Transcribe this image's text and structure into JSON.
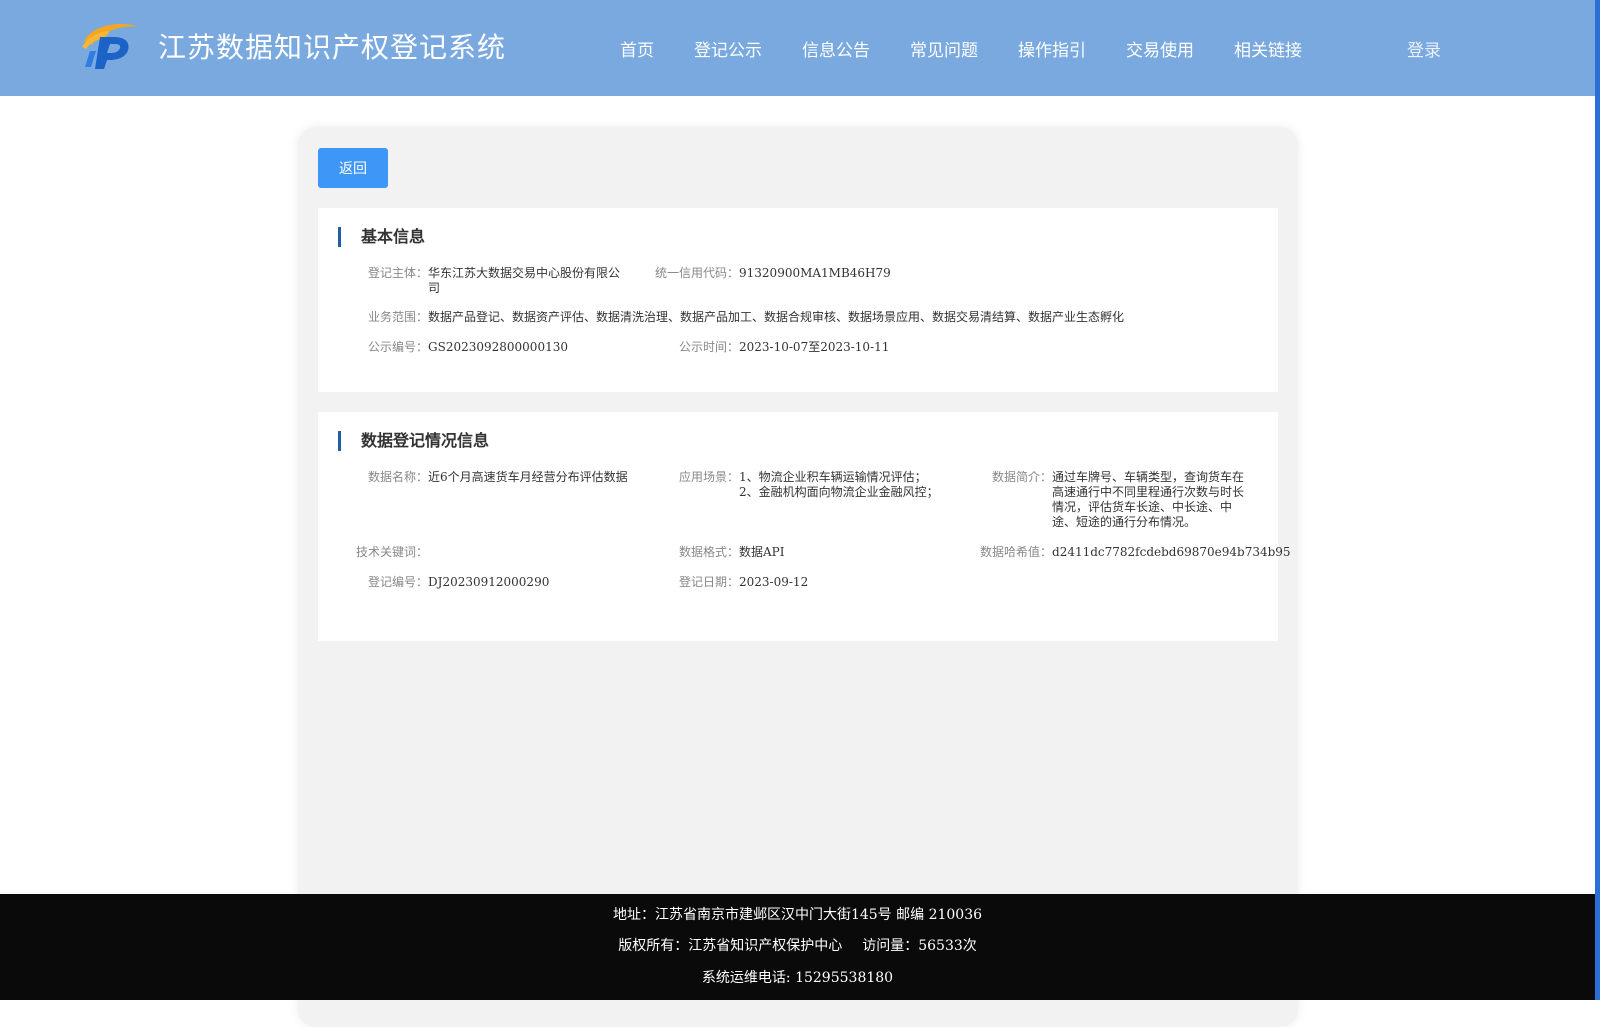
{
  "header": {
    "title": "江苏数据知识产权登记系统",
    "nav": [
      "首页",
      "登记公示",
      "信息公告",
      "常见问题",
      "操作指引",
      "交易使用",
      "相关链接"
    ],
    "login": "登录",
    "colors": {
      "background": "#79a9df",
      "logo_orange": "#f5a623",
      "logo_blue": "#1b63c6"
    }
  },
  "main": {
    "back_button": "返回",
    "basic_info": {
      "title": "基本信息",
      "registrant_label": "登记主体：",
      "registrant_value": "华东江苏大数据交易中心股份有限公司",
      "credit_code_label": "统一信用代码：",
      "credit_code_value": "91320900MA1MB46H79",
      "business_scope_label": "业务范围：",
      "business_scope_value": "数据产品登记、数据资产评估、数据清洗治理、数据产品加工、数据合规审核、数据场景应用、数据交易清结算、数据产业生态孵化",
      "notice_no_label": "公示编号：",
      "notice_no_value": "GS2023092800000130",
      "notice_time_label": "公示时间：",
      "notice_time_value": "2023-10-07至2023-10-11"
    },
    "registration_info": {
      "title": "数据登记情况信息",
      "data_name_label": "数据名称：",
      "data_name_value": "近6个月高速货车月经营分布评估数据",
      "scenario_label": "应用场景：",
      "scenario_line1": "1、物流企业积车辆运输情况评估；",
      "scenario_line2": "2、金融机构面向物流企业金融风控；",
      "summary_label": "数据简介：",
      "summary_value": "通过车牌号、车辆类型，查询货车在高速通行中不同里程通行次数与时长情况，评估货车长途、中长途、中途、短途的通行分布情况。",
      "keywords_label": "技术关键词：",
      "keywords_value": "",
      "format_label": "数据格式：",
      "format_value": "数据API",
      "hash_label": "数据哈希值：",
      "hash_value": "d2411dc7782fcdebd69870e94b734b95",
      "reg_no_label": "登记编号：",
      "reg_no_value": "DJ20230912000290",
      "reg_date_label": "登记日期：",
      "reg_date_value": "2023-09-12"
    }
  },
  "footer": {
    "address": "地址：江苏省南京市建邺区汉中门大街145号 邮编 210036",
    "copyright": "版权所有：江苏省知识产权保护中心",
    "visits": "访问量：56533次",
    "hotline": "系统运维电话: 15295538180"
  }
}
